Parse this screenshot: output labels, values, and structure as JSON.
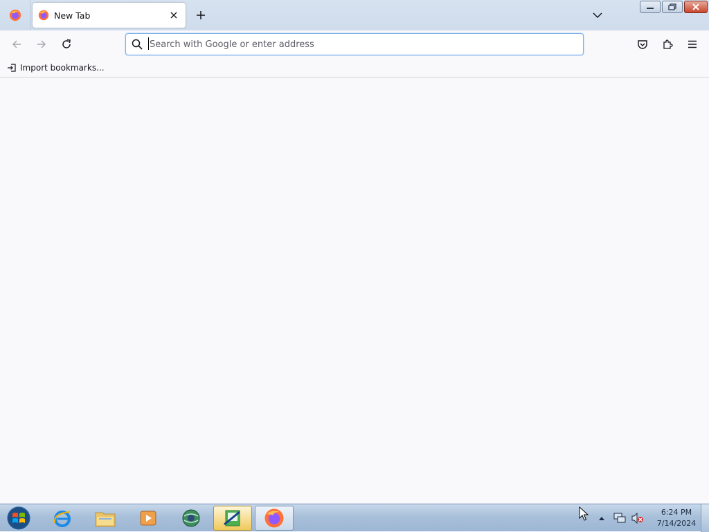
{
  "browser": {
    "tabs": [
      {
        "title": "New Tab",
        "close_icon": "close-icon"
      }
    ],
    "urlbar": {
      "placeholder": "Search with Google or enter address",
      "value": ""
    },
    "bookmarks": {
      "import_label": "Import bookmarks..."
    },
    "icons": {
      "menu": "firefox-logo-icon",
      "back": "back-arrow-icon",
      "forward": "forward-arrow-icon",
      "reload": "reload-icon",
      "pocket": "pocket-icon",
      "extensions": "puzzle-icon",
      "app_menu": "hamburger-menu-icon",
      "new_tab": "plus-icon",
      "tab_list": "chevron-down-icon"
    },
    "colors": {
      "urlbar_focus": "#7bb0e8",
      "firefox_orange": "#ff7139",
      "firefox_purple": "#9059ff"
    }
  },
  "taskbar": {
    "apps": [
      {
        "name": "Internet Explorer",
        "icon": "ie-icon"
      },
      {
        "name": "Windows Explorer",
        "icon": "folder-icon"
      },
      {
        "name": "Media Player",
        "icon": "media-player-icon"
      },
      {
        "name": "Network",
        "icon": "globe-icon"
      },
      {
        "name": "Notepad Editor",
        "icon": "editor-icon"
      },
      {
        "name": "Firefox",
        "icon": "firefox-icon"
      }
    ],
    "clock": {
      "time": "6:24 PM",
      "date": "7/14/2024"
    },
    "tray_icons": [
      "show-hidden-icons-arrow",
      "network-icon",
      "volume-muted-icon"
    ]
  }
}
